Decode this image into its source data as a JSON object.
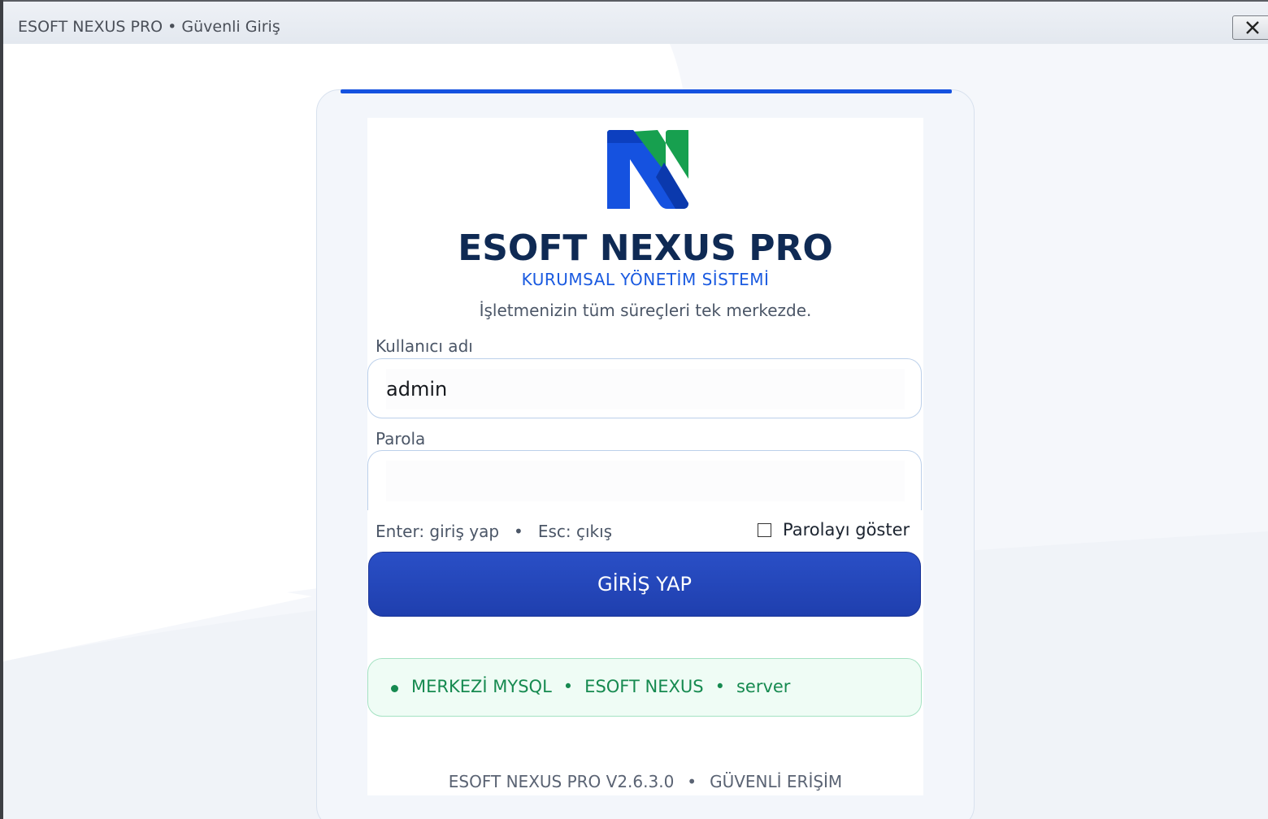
{
  "window": {
    "title": "ESOFT NEXUS PRO • Güvenli Giriş",
    "close_icon": "close-icon"
  },
  "brand": {
    "logo_icon": "nexus-logo-icon",
    "title": "ESOFT NEXUS PRO",
    "subtitle": "KURUMSAL YÖNETİM SİSTEMİ",
    "tagline": "İşletmenizin tüm süreçleri tek merkezde."
  },
  "form": {
    "username_label": "Kullanıcı adı",
    "username_value": "admin",
    "password_label": "Parola",
    "password_value": "",
    "hint_enter": "Enter: giriş yap",
    "hint_separator": "•",
    "hint_esc": "Esc: çıkış",
    "show_password_label": "Parolayı göster",
    "show_password_checked": false,
    "submit_label": "GİRİŞ YAP"
  },
  "status": {
    "db_label": "MERKEZİ MYSQL",
    "separator": "•",
    "app_label": "ESOFT NEXUS",
    "host_label": "server",
    "color": "#168a50"
  },
  "footer": {
    "version": "ESOFT NEXUS PRO V2.6.3.0",
    "separator": "•",
    "access": "GÜVENLİ ERİŞİM"
  },
  "colors": {
    "accent": "#1552e0",
    "button": "#2447b8",
    "title": "#0f2a54",
    "logo_blue": "#1552e0",
    "logo_green": "#17a04f"
  }
}
